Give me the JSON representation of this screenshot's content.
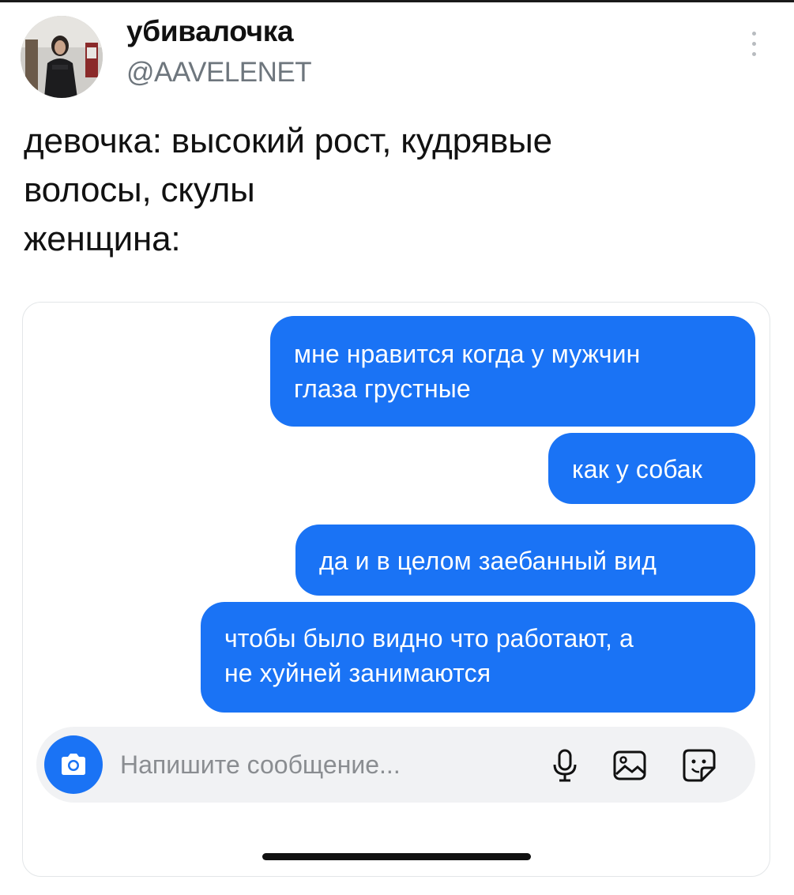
{
  "tweet": {
    "display_name": "убивалочка",
    "handle": "@AAVELENET",
    "text_lines": [
      "девочка: высокий рост, кудрявые",
      "волосы, скулы",
      "женщина:"
    ]
  },
  "chat": {
    "messages": [
      {
        "lines": [
          "мне нравится когда у мужчин",
          "глаза грустные"
        ]
      },
      {
        "lines": [
          "как у собак"
        ]
      },
      {
        "lines": [
          "да и в целом заебанный вид"
        ]
      },
      {
        "lines": [
          "чтобы было видно что работают, а",
          "не хуйней занимаются"
        ]
      }
    ],
    "composer": {
      "placeholder": "Напишите сообщение...",
      "icons": [
        "camera-icon",
        "microphone-icon",
        "image-icon",
        "sticker-icon"
      ]
    }
  },
  "colors": {
    "bubble": "#1a73f5",
    "handle": "#6e767d",
    "composer_bg": "#f1f2f4"
  }
}
